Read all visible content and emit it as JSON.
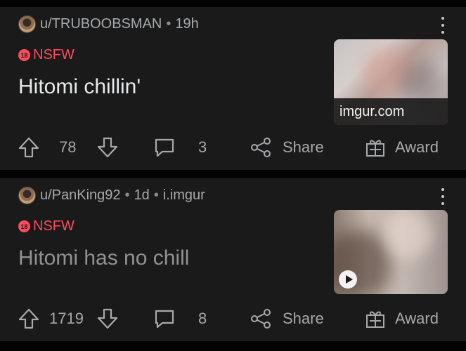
{
  "posts": [
    {
      "author": "u/TRUBOOBSMAN",
      "sep": "•",
      "time": "19h",
      "domain": "",
      "nsfw_label": "NSFW",
      "nsfw_badge": "18",
      "title": "Hitomi chillin'",
      "thumbnail_label": "imgur.com",
      "votes": "78",
      "comments": "3",
      "share_label": "Share",
      "award_label": "Award"
    },
    {
      "author": "u/PanKing92",
      "sep": "•",
      "time": "1d",
      "domain": "i.imgur",
      "nsfw_label": "NSFW",
      "nsfw_badge": "18",
      "title": "Hitomi has no chill",
      "thumbnail_label": "",
      "votes": "1719",
      "comments": "8",
      "share_label": "Share",
      "award_label": "Award"
    }
  ],
  "colors": {
    "background": "#030303",
    "card": "#1a1a1b",
    "nsfw": "#ff4b5c",
    "muted": "#a6a9ab"
  },
  "icons": [
    "more-icon",
    "upvote-icon",
    "downvote-icon",
    "comment-icon",
    "share-icon",
    "award-icon",
    "play-icon",
    "nsfw-badge-icon"
  ]
}
